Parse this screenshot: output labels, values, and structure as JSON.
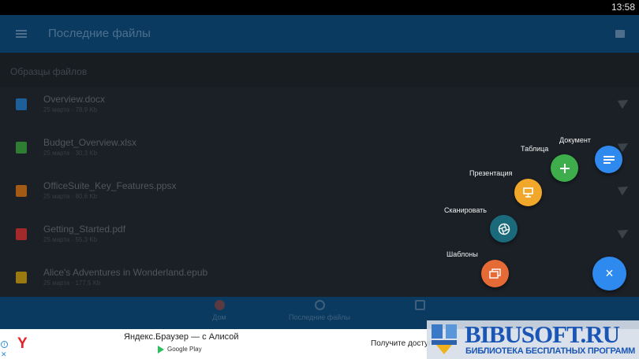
{
  "status_bar": {
    "time": "13:58"
  },
  "app_bar": {
    "title": "Последние файлы",
    "menu_icon": "hamburger-icon",
    "store_icon": "store-icon",
    "color": "#0a3a60"
  },
  "section": {
    "title": "Образцы файлов"
  },
  "files": [
    {
      "name": "Overview.docx",
      "meta": "25 марта · 78,9 Kb",
      "icon": "docx-icon",
      "color": "#1e5f9a"
    },
    {
      "name": "Budget_Overview.xlsx",
      "meta": "25 марта · 30,3 Kb",
      "icon": "xlsx-icon",
      "color": "#2e7d32"
    },
    {
      "name": "OfficeSuite_Key_Features.ppsx",
      "meta": "25 марта · 80,6 Kb",
      "icon": "ppsx-icon",
      "color": "#a35a14"
    },
    {
      "name": "Getting_Started.pdf",
      "meta": "25 марта · 55,3 Kb",
      "icon": "pdf-icon",
      "color": "#a32a2a"
    },
    {
      "name": "Alice's Adventures in Wonderland.epub",
      "meta": "25 марта · 177,5 Kb",
      "icon": "epub-icon",
      "color": "#9a7a10"
    }
  ],
  "bottom_nav": [
    {
      "label": "Дом",
      "icon": "home-icon"
    },
    {
      "label": "Последние файлы",
      "icon": "clock-icon"
    },
    {
      "label": "",
      "icon": "files-icon"
    }
  ],
  "fab_menu": {
    "items": [
      {
        "label": "Документ",
        "icon": "document-lines-icon",
        "color": "#2f8af0"
      },
      {
        "label": "Таблица",
        "icon": "plus-icon",
        "color": "#3dae4b"
      },
      {
        "label": "Презентация",
        "icon": "easel-icon",
        "color": "#f0a72a"
      },
      {
        "label": "Сканировать",
        "icon": "camera-shutter-icon",
        "color": "#1a6a7c"
      },
      {
        "label": "Шаблоны",
        "icon": "template-stack-icon",
        "color": "#e56a36"
      }
    ],
    "close_icon": "×"
  },
  "ad": {
    "title": "Яндекс.Браузер — с Алисой",
    "store": "Google Play",
    "cta": "Получите доступ",
    "logo": "Y"
  },
  "watermark": {
    "main": "BIBUSOFT.RU",
    "sub": "БИБЛИОТЕКА БЕСПЛАТНЫХ ПРОГРАММ"
  }
}
